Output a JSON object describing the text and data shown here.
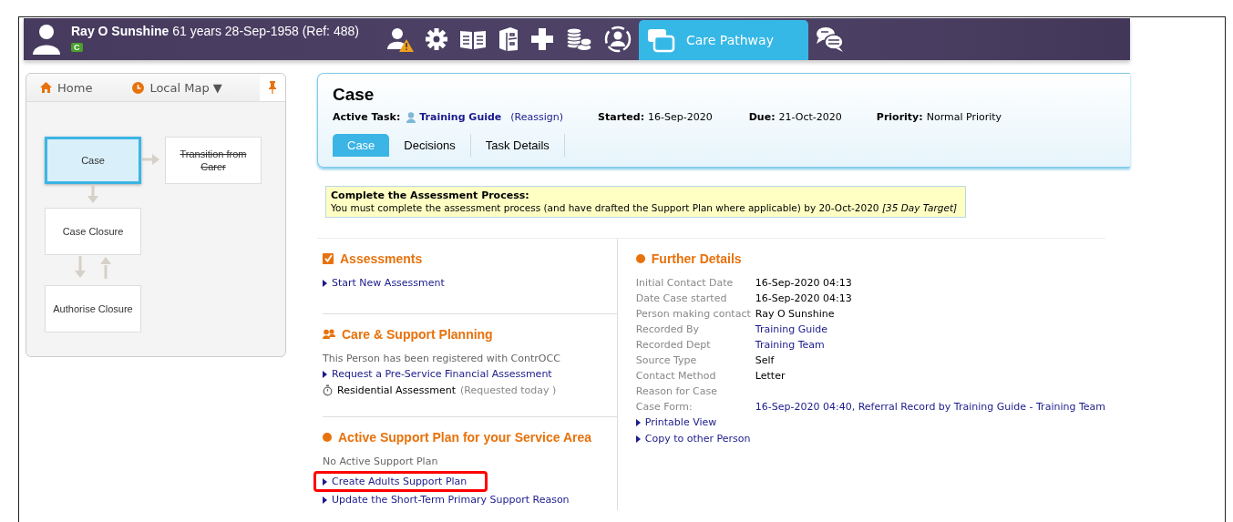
{
  "top_bar": {
    "patient_name": "Ray O Sunshine",
    "patient_details": "61 years 28-Sep-1958 (Ref: 488)",
    "badge": "C",
    "tabs": [
      {
        "label": "Care Pathway",
        "selected": true
      }
    ]
  },
  "sidebar": {
    "nav": [
      {
        "kind": "home",
        "label": "Home"
      },
      {
        "kind": "map",
        "label": "Local Map ▼"
      }
    ],
    "map_nodes": [
      {
        "label": "Case",
        "selected": true,
        "disabled": false
      },
      {
        "label": "Transition from Carer",
        "selected": false,
        "disabled": true
      },
      {
        "label": "Case Closure",
        "selected": false,
        "disabled": false
      },
      {
        "label": "Authorise Closure",
        "selected": false,
        "disabled": false
      }
    ]
  },
  "case_panel": {
    "title": "Case",
    "active_task_label": "Active Task:",
    "active_task_user": "Training Guide",
    "reassign": "(Reassign)",
    "meta": [
      {
        "label": "Started:",
        "value": "16-Sep-2020"
      },
      {
        "label": "Due:",
        "value": "21-Oct-2020"
      },
      {
        "label": "Priority:",
        "value": "Normal Priority"
      }
    ],
    "tabs": [
      {
        "label": "Case",
        "selected": true
      },
      {
        "label": "Decisions",
        "selected": false
      },
      {
        "label": "Task Details",
        "selected": false
      }
    ]
  },
  "notice": {
    "title": "Complete the Assessment Process:",
    "text": "You must complete the assessment process (and have drafted the Support Plan where applicable) by 20-Oct-2020 *[35 Day Target]*"
  },
  "sections": [
    {
      "kind": "checkbox",
      "title": "Assessments",
      "items": [
        {
          "kind": "link",
          "text": "Start New Assessment",
          "highlighted": false
        }
      ]
    },
    {
      "kind": "people",
      "title": "Care & Support Planning",
      "items": [
        {
          "kind": "note",
          "text": "This Person has been registered with ContrOCC"
        },
        {
          "kind": "link",
          "text": "Request a Pre-Service Financial Assessment",
          "highlighted": false
        },
        {
          "kind": "pending",
          "text": "Residential Assessment",
          "status": "(Requested today )"
        }
      ]
    },
    {
      "kind": "dot",
      "title": "Active Support Plan for your Service Area",
      "items": [
        {
          "kind": "note",
          "text": "No Active Support Plan"
        },
        {
          "kind": "link",
          "text": "Create Adults Support Plan",
          "highlighted": true
        },
        {
          "kind": "link",
          "text": "Update the Short-Term Primary Support Reason",
          "highlighted": false
        }
      ]
    }
  ],
  "further_details": {
    "title": "Further Details",
    "fields": [
      {
        "label": "Initial Contact Date",
        "value": "16-Sep-2020 04:13",
        "kind": "text"
      },
      {
        "label": "Date Case started",
        "value": "16-Sep-2020 04:13",
        "kind": "text"
      },
      {
        "label": "Person making contact",
        "value": "Ray O Sunshine",
        "kind": "text"
      },
      {
        "label": "Recorded By",
        "value": "Training Guide",
        "kind": "link"
      },
      {
        "label": "Recorded Dept",
        "value": "Training Team",
        "kind": "link"
      },
      {
        "label": "Source Type",
        "value": "Self",
        "kind": "text"
      },
      {
        "label": "Contact Method",
        "value": "Letter",
        "kind": "text"
      },
      {
        "label": "Reason for Case"
      },
      {
        "label": "Case Form:",
        "value": "16-Sep-2020 04:40, Referral Record by Training Guide - Training Team",
        "kind": "link"
      }
    ],
    "links": [
      "Printable View",
      "Copy to other Person"
    ]
  }
}
